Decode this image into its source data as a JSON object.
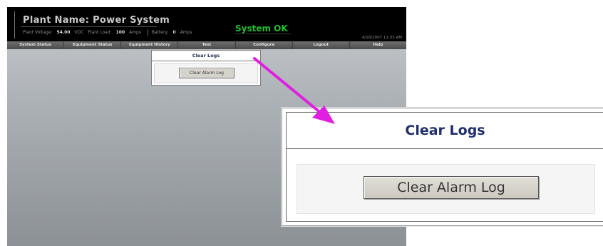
{
  "header": {
    "plant_name": "Plant Name:  Power System",
    "metrics": {
      "voltage_label": "Plant Voltage:",
      "voltage_value": "54.00",
      "voltage_unit": "VDC",
      "load_label": "Plant Load:",
      "load_value": "100",
      "load_unit": "Amps",
      "battery_label": "Battery:",
      "battery_value": "0",
      "battery_unit": "Amps"
    },
    "system_status": "System OK",
    "datetime": "4/18/2007 11:33 AM"
  },
  "nav": {
    "items": [
      {
        "label": "System Status"
      },
      {
        "label": "Equipment Status"
      },
      {
        "label": "Equipment History"
      },
      {
        "label": "Test"
      },
      {
        "label": "Configure"
      },
      {
        "label": "Logout"
      },
      {
        "label": "Help"
      }
    ]
  },
  "dialog": {
    "title": "Clear Logs",
    "button_label": "Clear Alarm Log"
  },
  "colors": {
    "arrow": "#e020e0",
    "status_ok": "#1fbf2c",
    "title_text": "#1f2f6e"
  }
}
